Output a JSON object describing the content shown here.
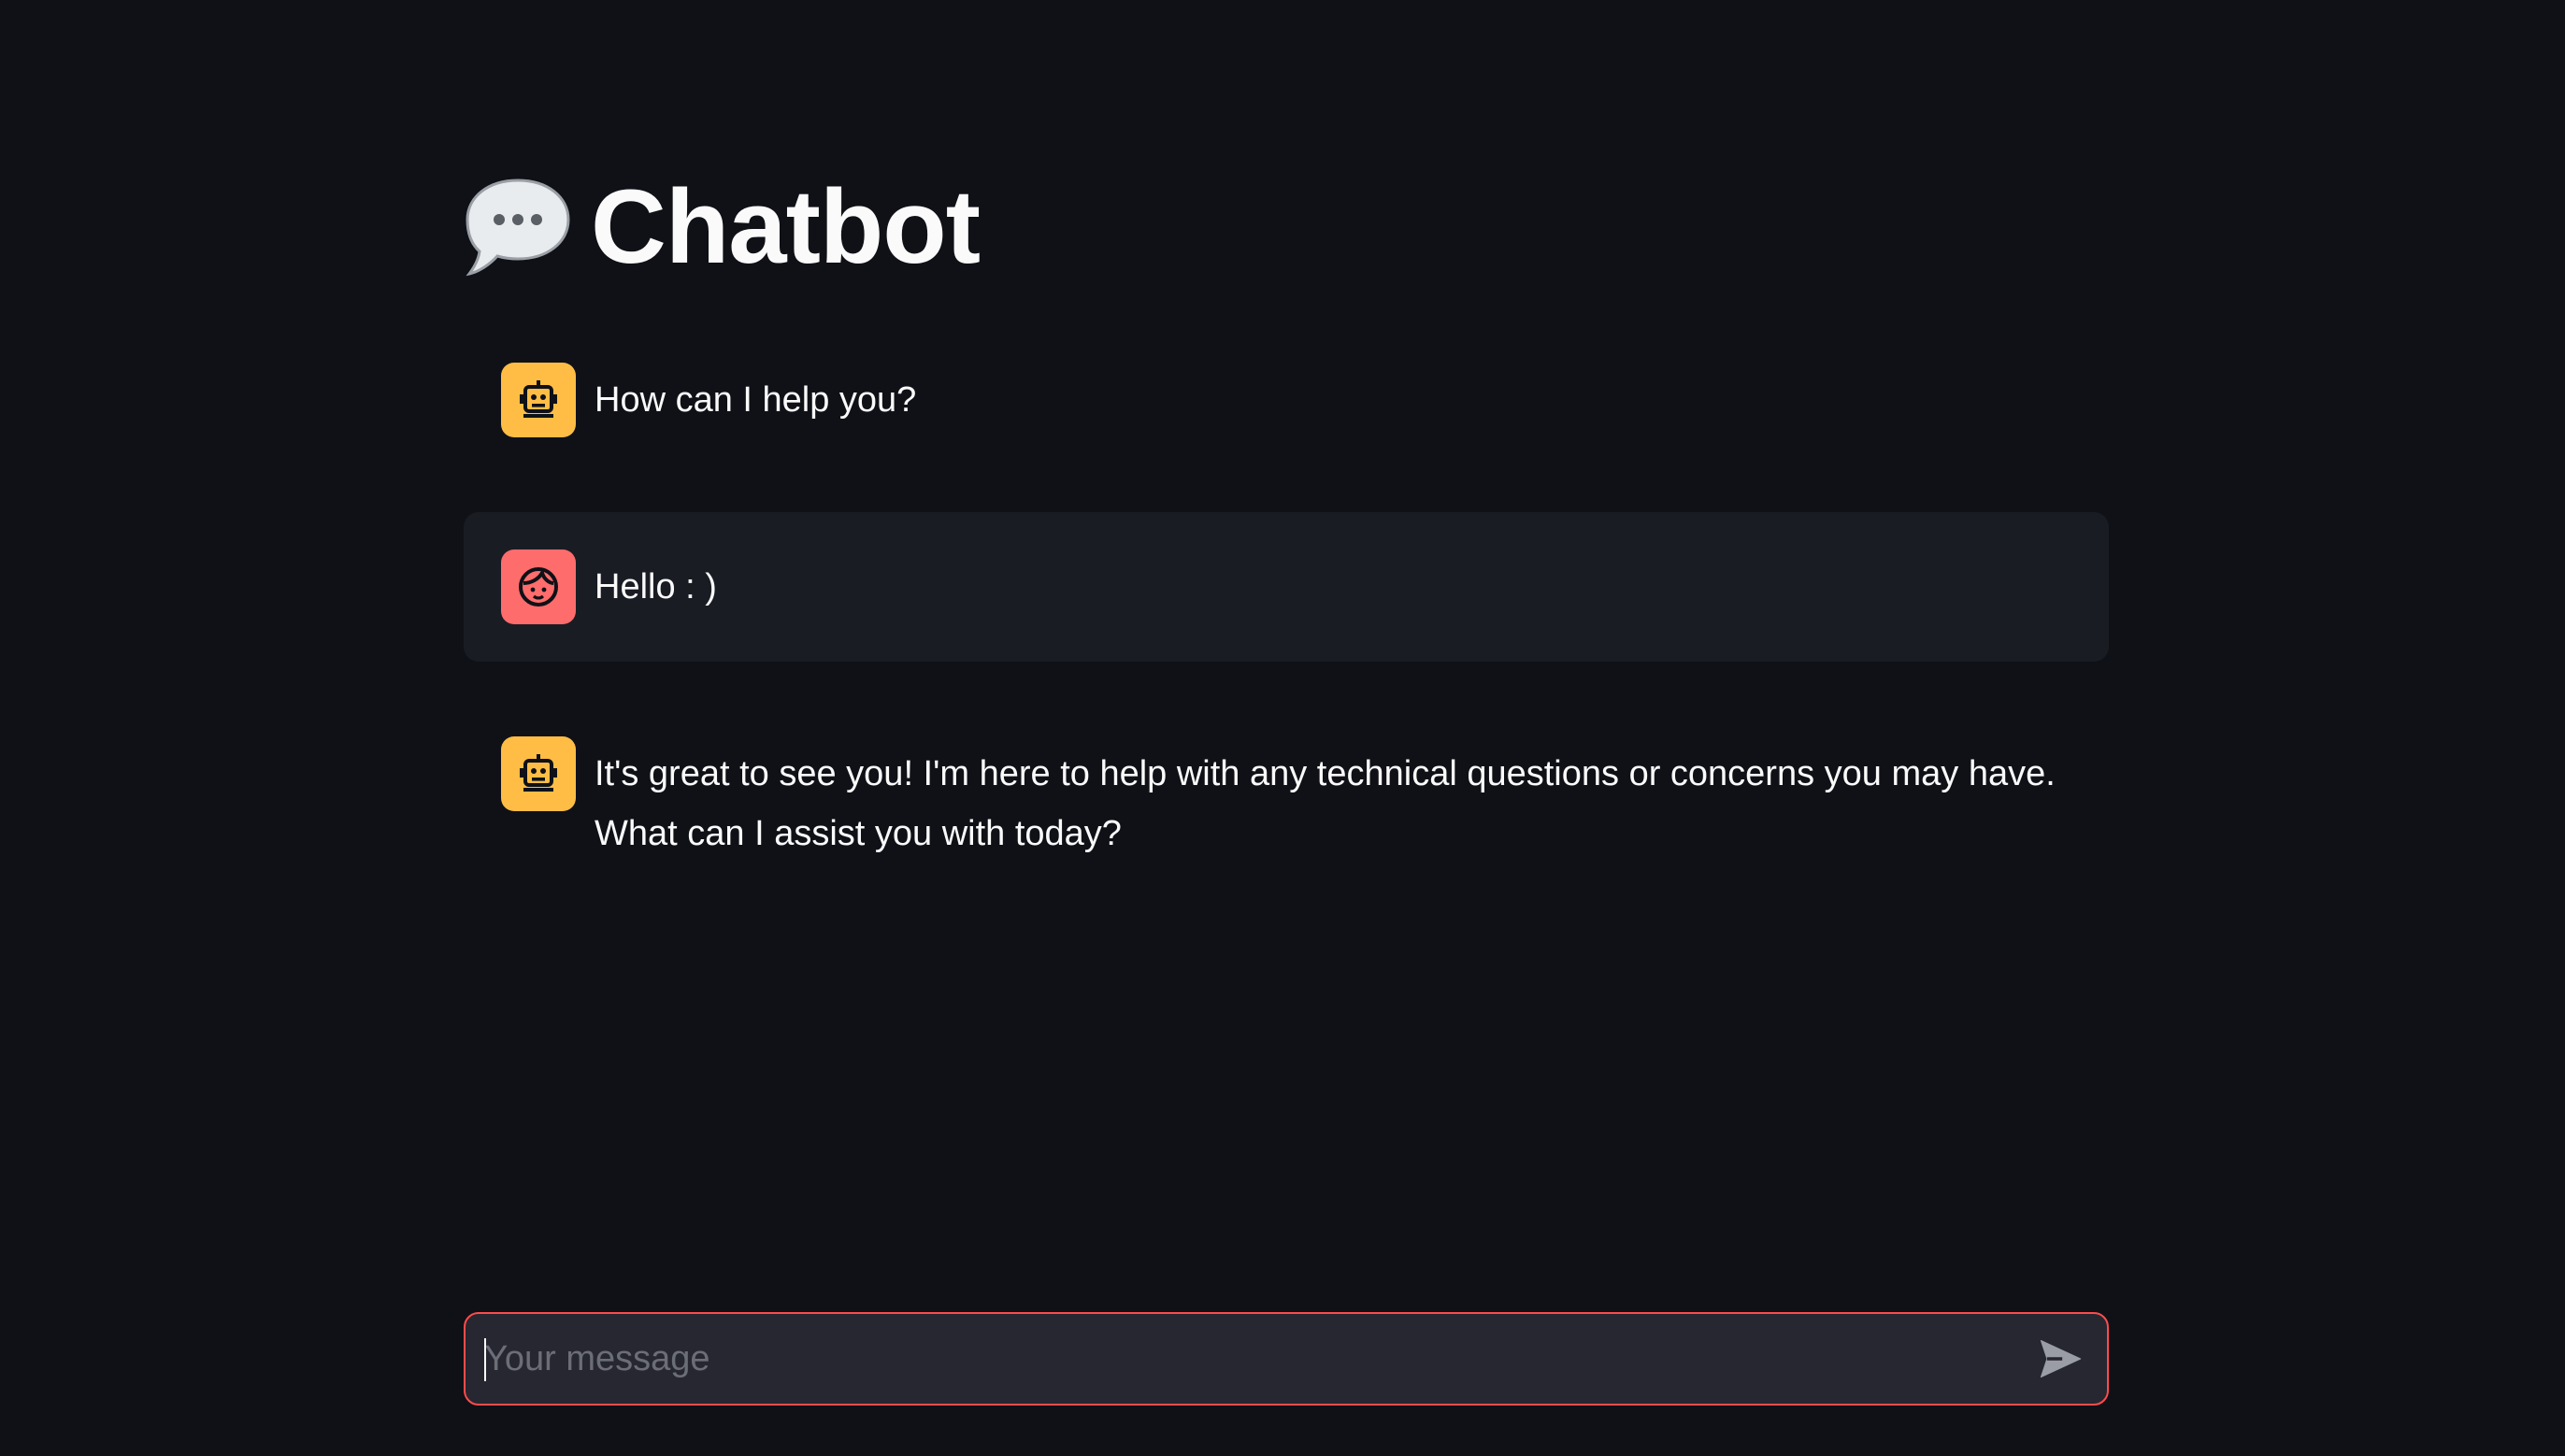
{
  "page": {
    "title": "Chatbot",
    "title_icon": "speech-balloon-icon"
  },
  "messages": [
    {
      "role": "assistant",
      "avatar_icon": "robot-icon",
      "text": "How can I help you?"
    },
    {
      "role": "user",
      "avatar_icon": "face-icon",
      "text": "Hello : )"
    },
    {
      "role": "assistant",
      "avatar_icon": "robot-icon",
      "text": "It's great to see you! I'm here to help with any technical questions or concerns you may have. What can I assist you with today?"
    }
  ],
  "chat_input": {
    "placeholder": "Your message",
    "value": "",
    "send_icon": "send-icon"
  },
  "colors": {
    "background": "#0f1117",
    "assistant_avatar": "#ffbd45",
    "user_avatar": "#ff6c6c",
    "user_message_bg": "#1a1c24",
    "input_border": "#ff4b4b",
    "input_bg": "#262730"
  }
}
